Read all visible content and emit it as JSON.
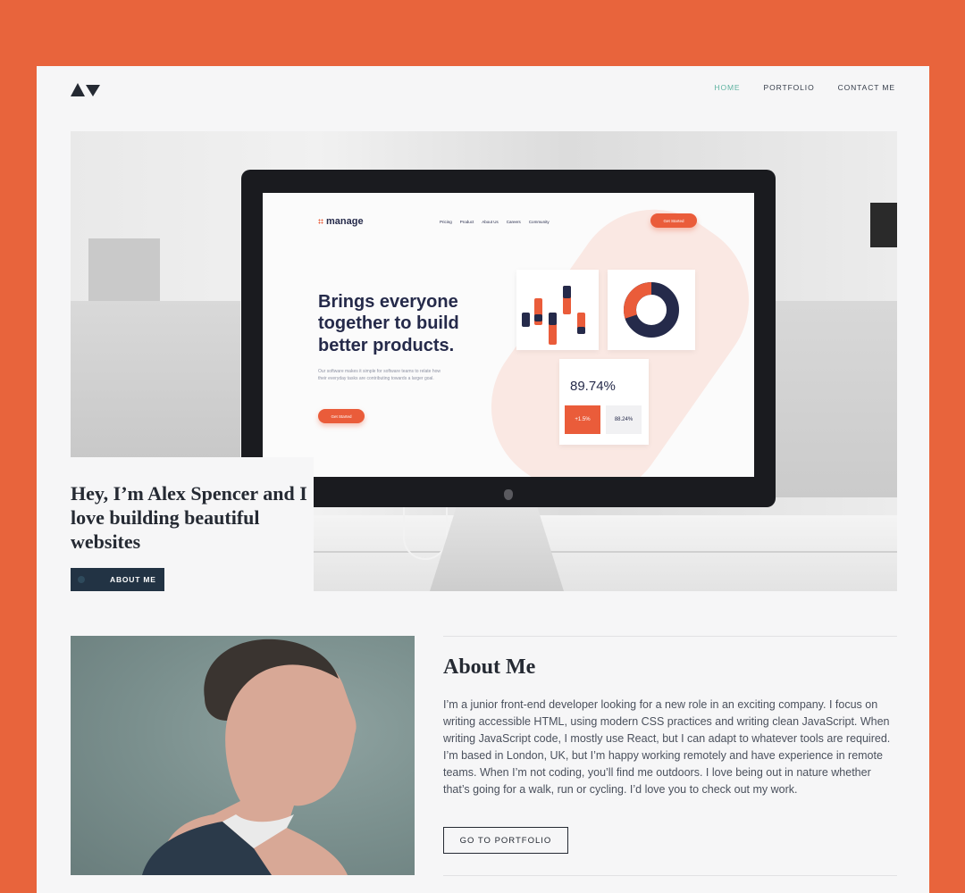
{
  "colors": {
    "background": "#e8643c",
    "page": "#f6f6f7",
    "nav_active": "#5fb3a1",
    "dark": "#252a33",
    "button": "#223344",
    "manage_orange": "#ea5c3a",
    "manage_navy": "#252a4a"
  },
  "header": {
    "logo_icon": "triangle-logo-icon",
    "nav": [
      {
        "label": "HOME",
        "active": true
      },
      {
        "label": "PORTFOLIO",
        "active": false
      },
      {
        "label": "CONTACT ME",
        "active": false
      }
    ]
  },
  "hero": {
    "title": "Hey, I’m Alex Spencer and I love building beautiful websites",
    "button_label": "ABOUT ME",
    "screen": {
      "brand": "manage",
      "nav": [
        "Pricing",
        "Product",
        "About Us",
        "Careers",
        "Community"
      ],
      "cta_top": "Get Started",
      "headline": "Brings everyone together to build better products.",
      "text": "Our software makes it simple for software teams to relate how their everyday tasks are contributing towards a larger goal.",
      "cta_main": "Get Started",
      "stat_main": "89.74%",
      "stat_a": "+1.5%",
      "stat_b": "88.24%"
    }
  },
  "about": {
    "title": "About Me",
    "body": "I’m a junior front-end developer looking for a new role in an exciting company. I focus on writing accessible HTML, using modern CSS practices and writing clean JavaScript. When writing JavaScript code, I mostly use React, but I can adapt to whatever tools are required. I’m based in London, UK, but I’m happy working remotely and have experience in remote teams. When I’m not coding, you’ll find me outdoors. I love being out in nature whether that’s going for a walk, run or cycling. I’d love you to check out my work.",
    "button_label": "GO TO PORTFOLIO"
  }
}
